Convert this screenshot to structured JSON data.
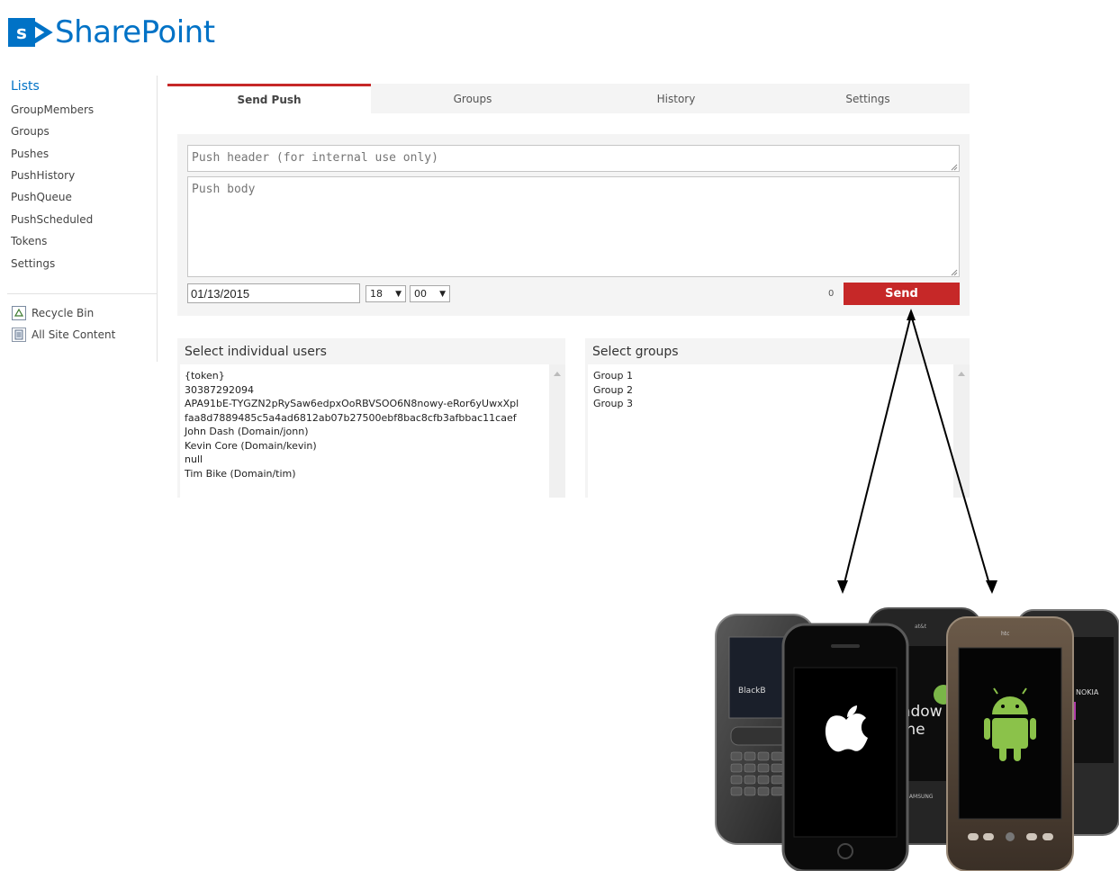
{
  "app": {
    "logo_letter": "s",
    "title": "SharePoint",
    "brand_color": "#0072c6",
    "accent_color": "#c62828"
  },
  "nav": {
    "heading": "Lists",
    "items": [
      "GroupMembers",
      "Groups",
      "Pushes",
      "PushHistory",
      "PushQueue",
      "PushScheduled",
      "Tokens",
      "Settings"
    ],
    "utilities": [
      {
        "label": "Recycle Bin",
        "icon": "recycle-bin-icon"
      },
      {
        "label": "All Site Content",
        "icon": "site-content-icon"
      }
    ]
  },
  "tabs": [
    {
      "label": "Send Push",
      "active": true
    },
    {
      "label": "Groups",
      "active": false
    },
    {
      "label": "History",
      "active": false
    },
    {
      "label": "Settings",
      "active": false
    }
  ],
  "compose": {
    "header_placeholder": "Push header (for internal use only)",
    "body_placeholder": "Push body",
    "date": "01/13/2015",
    "hour": "18",
    "minute": "00",
    "char_count": "0",
    "send_label": "Send"
  },
  "users_panel": {
    "title": "Select individual users",
    "options": [
      "{token}",
      "30387292094",
      "APA91bE-TYGZN2pRySaw6edpxOoRBVSOO6N8nowy-eRor6yUwxXpl",
      "faa8d7889485c5a4ad6812ab07b27500ebf8bac8cfb3afbbac11caef",
      "John Dash (Domain/jonn)",
      "Kevin Core (Domain/kevin)",
      "null",
      "Tim Bike (Domain/tim)"
    ]
  },
  "groups_panel": {
    "title": "Select groups",
    "options": [
      "Group 1",
      "Group 2",
      "Group 3"
    ]
  },
  "illustration": {
    "phones": [
      "blackberry-phone",
      "iphone",
      "windows-phone",
      "android-phone",
      "nokia-phone"
    ],
    "phone_screen_text": {
      "blackberry": "BlackB",
      "windows": "indow\none",
      "samsung": "SAMSUNG",
      "htc": "htc",
      "nokia": "NOKIA",
      "att": "at&t"
    }
  }
}
